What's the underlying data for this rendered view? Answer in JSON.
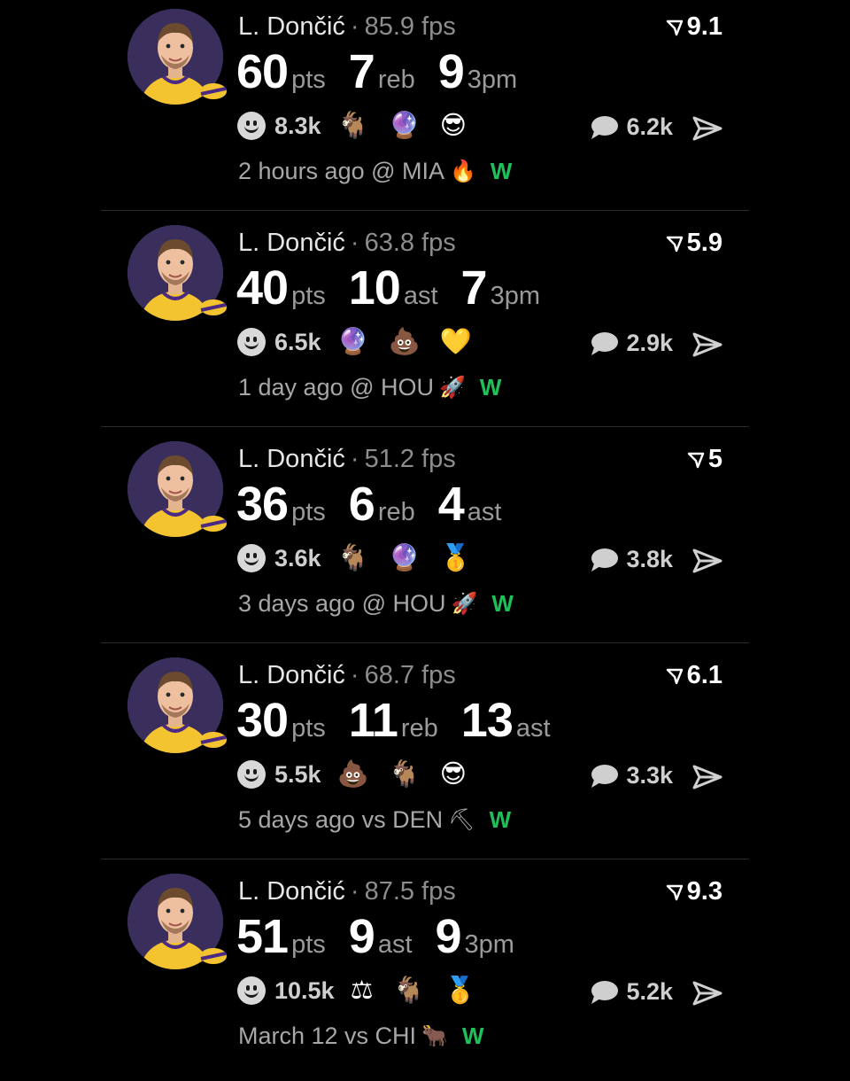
{
  "posts": [
    {
      "player": "L. Dončić",
      "fps": "85.9 fps",
      "rating": "9.1",
      "stats": [
        {
          "num": "60",
          "unit": "pts"
        },
        {
          "num": "7",
          "unit": "reb"
        },
        {
          "num": "9",
          "unit": "3pm"
        }
      ],
      "reactions_count": "8.3k",
      "emojis": [
        "🐐",
        "🔮",
        "😎"
      ],
      "comments": "6.2k",
      "time": "2 hours ago @ MIA",
      "opponent_icon": "🔥",
      "result": "W"
    },
    {
      "player": "L. Dončić",
      "fps": "63.8 fps",
      "rating": "5.9",
      "stats": [
        {
          "num": "40",
          "unit": "pts"
        },
        {
          "num": "10",
          "unit": "ast"
        },
        {
          "num": "7",
          "unit": "3pm"
        }
      ],
      "reactions_count": "6.5k",
      "emojis": [
        "🔮",
        "💩",
        "💛"
      ],
      "comments": "2.9k",
      "time": "1 day ago @ HOU",
      "opponent_icon": "🚀",
      "result": "W"
    },
    {
      "player": "L. Dončić",
      "fps": "51.2 fps",
      "rating": "5",
      "stats": [
        {
          "num": "36",
          "unit": "pts"
        },
        {
          "num": "6",
          "unit": "reb"
        },
        {
          "num": "4",
          "unit": "ast"
        }
      ],
      "reactions_count": "3.6k",
      "emojis": [
        "🐐",
        "🔮",
        "🥇"
      ],
      "comments": "3.8k",
      "time": "3 days ago @ HOU",
      "opponent_icon": "🚀",
      "result": "W"
    },
    {
      "player": "L. Dončić",
      "fps": "68.7 fps",
      "rating": "6.1",
      "stats": [
        {
          "num": "30",
          "unit": "pts"
        },
        {
          "num": "11",
          "unit": "reb"
        },
        {
          "num": "13",
          "unit": "ast"
        }
      ],
      "reactions_count": "5.5k",
      "emojis": [
        "💩",
        "🐐",
        "😎"
      ],
      "comments": "3.3k",
      "time": "5 days ago vs DEN",
      "opponent_icon": "⛏",
      "result": "W"
    },
    {
      "player": "L. Dončić",
      "fps": "87.5 fps",
      "rating": "9.3",
      "stats": [
        {
          "num": "51",
          "unit": "pts"
        },
        {
          "num": "9",
          "unit": "ast"
        },
        {
          "num": "9",
          "unit": "3pm"
        }
      ],
      "reactions_count": "10.5k",
      "emojis": [
        "⚖",
        "🐐",
        "🥇"
      ],
      "comments": "5.2k",
      "time": "March 12 vs CHI",
      "opponent_icon": "🐂",
      "result": "W"
    }
  ],
  "colors": {
    "background": "#000000",
    "win": "#1fbf5a",
    "avatar_bg": "#3a2f5c",
    "jersey": "#f4c430"
  },
  "icons": {
    "rating": "rating-arrow-icon",
    "reaction": "smile-icon",
    "comment": "comment-bubble-icon",
    "share": "share-arrow-icon"
  }
}
